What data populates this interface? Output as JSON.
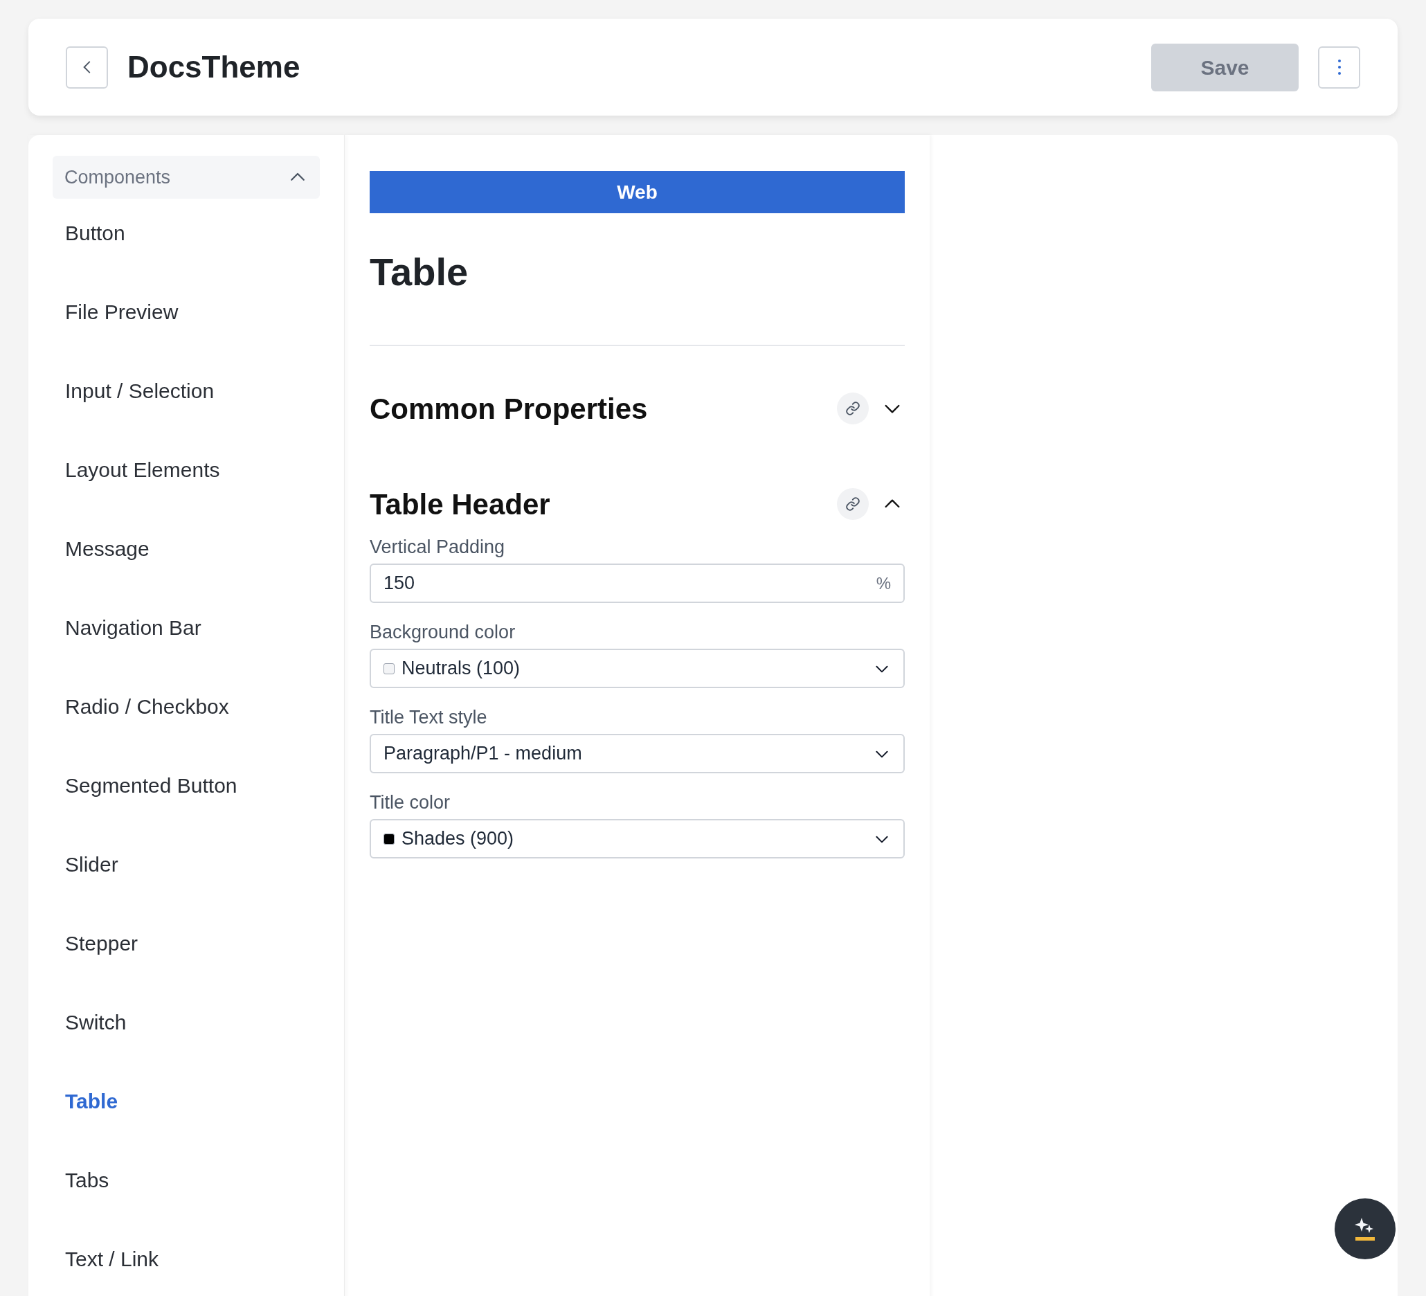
{
  "header": {
    "title": "DocsTheme",
    "save_button": {
      "label": "Save",
      "disabled": true
    }
  },
  "sidebar": {
    "group": {
      "label": "Components",
      "expanded": true
    },
    "items": [
      {
        "label": "Button",
        "selected": false
      },
      {
        "label": "File Preview",
        "selected": false
      },
      {
        "label": "Input / Selection",
        "selected": false
      },
      {
        "label": "Layout Elements",
        "selected": false
      },
      {
        "label": "Message",
        "selected": false
      },
      {
        "label": "Navigation Bar",
        "selected": false
      },
      {
        "label": "Radio / Checkbox",
        "selected": false
      },
      {
        "label": "Segmented Button",
        "selected": false
      },
      {
        "label": "Slider",
        "selected": false
      },
      {
        "label": "Stepper",
        "selected": false
      },
      {
        "label": "Switch",
        "selected": false
      },
      {
        "label": "Table",
        "selected": true
      },
      {
        "label": "Tabs",
        "selected": false
      },
      {
        "label": "Text / Link",
        "selected": false
      }
    ]
  },
  "editor": {
    "platform_tab": "Web",
    "title": "Table",
    "sections": [
      {
        "title": "Common Properties",
        "expanded": false
      },
      {
        "title": "Table Header",
        "expanded": true,
        "fields": [
          {
            "kind": "input",
            "label": "Vertical Padding",
            "value": "150",
            "suffix": "%"
          },
          {
            "kind": "select",
            "label": "Background color",
            "value": "Neutrals (100)",
            "color": "#f3f4f6"
          },
          {
            "kind": "select",
            "label": "Title Text style",
            "value": "Paragraph/P1 - medium"
          },
          {
            "kind": "select",
            "label": "Title color",
            "value": "Shades (900)",
            "color": "#000000"
          }
        ]
      }
    ]
  }
}
